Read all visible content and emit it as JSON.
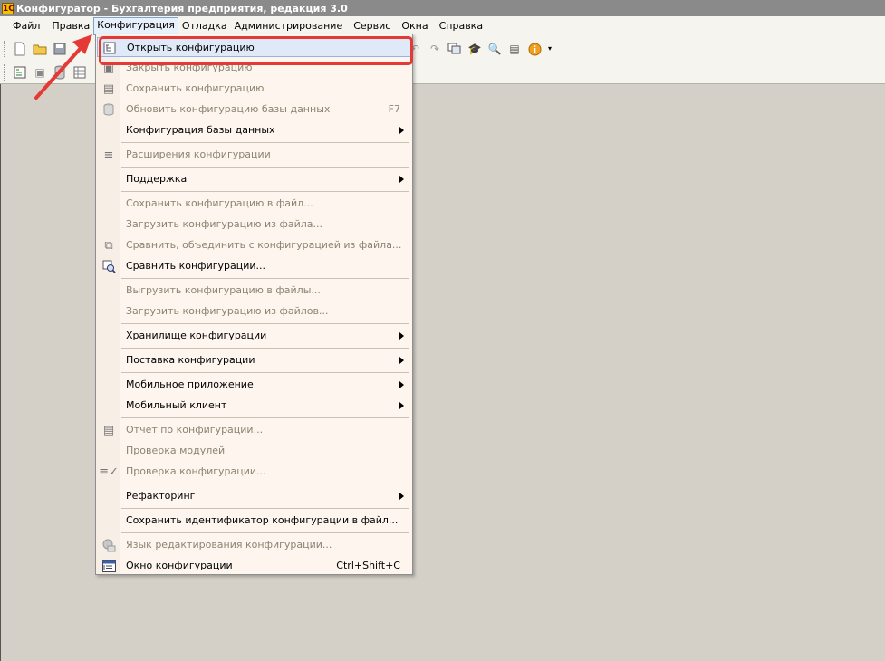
{
  "window": {
    "title": "Конфигуратор - Бухгалтерия предприятия, редакция 3.0",
    "app_icon_glyph": "1С"
  },
  "menubar": {
    "items": [
      {
        "label": "Файл"
      },
      {
        "label": "Правка"
      },
      {
        "label": "Конфигурация"
      },
      {
        "label": "Отладка"
      },
      {
        "label": "Администрирование"
      },
      {
        "label": "Сервис"
      },
      {
        "label": "Окна"
      },
      {
        "label": "Справка"
      }
    ]
  },
  "config_menu": {
    "items": [
      {
        "label": "Открыть конфигурацию",
        "icon": "open-config-icon",
        "enabled": true,
        "highlighted": true
      },
      {
        "label": "Закрыть конфигурацию",
        "icon": "close-config-icon",
        "enabled": false
      },
      {
        "label": "Сохранить конфигурацию",
        "icon": "save-config-icon",
        "enabled": false
      },
      {
        "label": "Обновить конфигурацию базы данных",
        "shortcut": "F7",
        "icon": "database-icon",
        "enabled": false
      },
      {
        "label": "Конфигурация базы данных",
        "submenu": true,
        "enabled": true
      },
      {
        "label": "Расширения конфигурации",
        "icon": "extensions-icon",
        "enabled": false
      },
      {
        "label": "Поддержка",
        "submenu": true,
        "enabled": true
      },
      {
        "label": "Сохранить конфигурацию в файл...",
        "enabled": false
      },
      {
        "label": "Загрузить конфигурацию из файла...",
        "enabled": false
      },
      {
        "label": "Сравнить, объединить с конфигурацией из файла...",
        "icon": "compare-merge-icon",
        "enabled": false
      },
      {
        "label": "Сравнить конфигурации...",
        "icon": "compare-icon",
        "enabled": true
      },
      {
        "label": "Выгрузить конфигурацию в файлы...",
        "enabled": false
      },
      {
        "label": "Загрузить конфигурацию из файлов...",
        "enabled": false
      },
      {
        "label": "Хранилище конфигурации",
        "submenu": true,
        "enabled": true
      },
      {
        "label": "Поставка конфигурации",
        "submenu": true,
        "enabled": true
      },
      {
        "label": "Мобильное приложение",
        "submenu": true,
        "enabled": true
      },
      {
        "label": "Мобильный клиент",
        "submenu": true,
        "enabled": true
      },
      {
        "label": "Отчет по конфигурации...",
        "icon": "report-icon",
        "enabled": false
      },
      {
        "label": "Проверка модулей",
        "enabled": false
      },
      {
        "label": "Проверка конфигурации...",
        "icon": "check-icon",
        "enabled": false
      },
      {
        "label": "Рефакторинг",
        "submenu": true,
        "enabled": true
      },
      {
        "label": "Сохранить идентификатор конфигурации в файл...",
        "enabled": true
      },
      {
        "label": "Язык редактирования конфигурации...",
        "icon": "language-icon",
        "enabled": false
      },
      {
        "label": "Окно конфигурации",
        "shortcut": "Ctrl+Shift+C",
        "icon": "config-window-icon",
        "enabled": true
      }
    ]
  },
  "annotation": {
    "color": "#e53935"
  }
}
